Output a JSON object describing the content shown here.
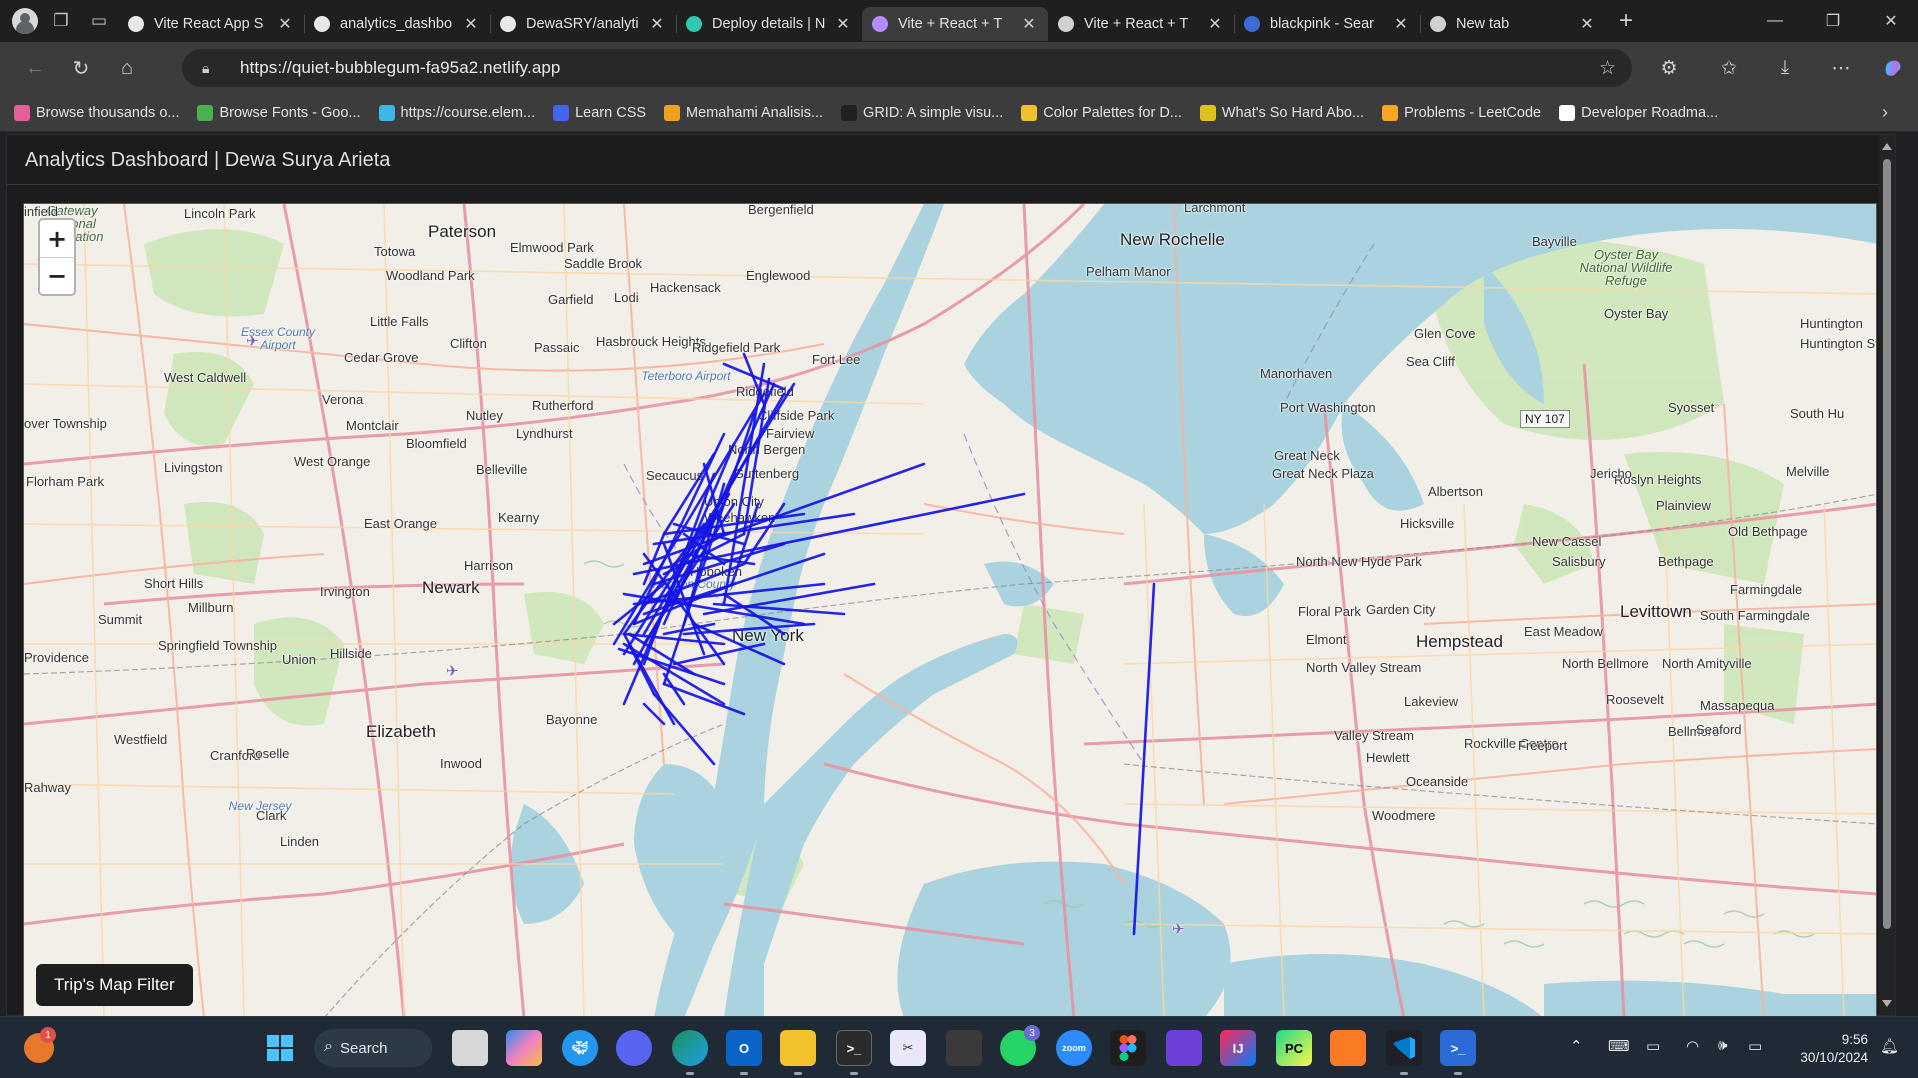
{
  "browser": {
    "tabs": [
      {
        "title": "Vite React App S",
        "favicon_color": "#e8e8e8",
        "active": false
      },
      {
        "title": "analytics_dashbo",
        "favicon_color": "#e8e8e8",
        "active": false
      },
      {
        "title": "DewaSRY/analyti",
        "favicon_color": "#e8e8e8",
        "active": false
      },
      {
        "title": "Deploy details | N",
        "favicon_color": "#30c8b4",
        "active": false
      },
      {
        "title": "Vite + React + T",
        "favicon_color": "#b48cff",
        "active": true
      },
      {
        "title": "Vite + React + T",
        "favicon_color": "#d0d0d0",
        "active": false
      },
      {
        "title": "blackpink - Sear",
        "favicon_color": "#3c6cd8",
        "active": false
      },
      {
        "title": "New tab",
        "favicon_color": "#d0d0d0",
        "active": false
      }
    ],
    "url": "https://quiet-bubblegum-fa95a2.netlify.app",
    "bookmarks": [
      {
        "label": "Browse thousands o...",
        "color": "#e45f9a"
      },
      {
        "label": "Browse Fonts - Goo...",
        "color": "#4caf50"
      },
      {
        "label": "https://course.elem...",
        "color": "#3eb6e8"
      },
      {
        "label": "Learn CSS",
        "color": "#4466ee"
      },
      {
        "label": "Memahami Analisis...",
        "color": "#f0a020"
      },
      {
        "label": "GRID: A simple visu...",
        "color": "#202020"
      },
      {
        "label": "Color Palettes for D...",
        "color": "#f0c030"
      },
      {
        "label": "What's So Hard Abo...",
        "color": "#e0c020"
      },
      {
        "label": "Problems - LeetCode",
        "color": "#f5a623"
      },
      {
        "label": "Developer Roadma...",
        "color": "#ffffff"
      }
    ]
  },
  "page": {
    "title": "Analytics Dashboard | Dewa Surya Arieta",
    "filter_button": "Trip's Map Filter",
    "zoom_in": "+",
    "zoom_out": "−"
  },
  "map": {
    "places": [
      {
        "name": "Lincoln Park",
        "cls": ""
      },
      {
        "name": "Paterson",
        "cls": "big"
      },
      {
        "name": "Totowa",
        "cls": ""
      },
      {
        "name": "Elmwood Park",
        "cls": ""
      },
      {
        "name": "Saddle Brook",
        "cls": ""
      },
      {
        "name": "Woodland Park",
        "cls": ""
      },
      {
        "name": "Hackensack",
        "cls": ""
      },
      {
        "name": "Englewood",
        "cls": ""
      },
      {
        "name": "Bergenfield",
        "cls": ""
      },
      {
        "name": "New Rochelle",
        "cls": "big"
      },
      {
        "name": "Pelham Manor",
        "cls": ""
      },
      {
        "name": "Larchmont",
        "cls": ""
      },
      {
        "name": "Bayville",
        "cls": ""
      },
      {
        "name": "Oyster Bay National Wildlife Refuge",
        "cls": "park"
      },
      {
        "name": "Oyster Bay",
        "cls": ""
      },
      {
        "name": "Glen Cove",
        "cls": ""
      },
      {
        "name": "Sea Cliff",
        "cls": ""
      },
      {
        "name": "Huntington",
        "cls": ""
      },
      {
        "name": "Huntington Station",
        "cls": ""
      },
      {
        "name": "Little Falls",
        "cls": ""
      },
      {
        "name": "Garfield",
        "cls": ""
      },
      {
        "name": "Lodi",
        "cls": ""
      },
      {
        "name": "Clifton",
        "cls": ""
      },
      {
        "name": "Passaic",
        "cls": ""
      },
      {
        "name": "Hasbrouck Heights",
        "cls": ""
      },
      {
        "name": "Ridgefield Park",
        "cls": ""
      },
      {
        "name": "Fort Lee",
        "cls": ""
      },
      {
        "name": "Teterboro Airport",
        "cls": "water"
      },
      {
        "name": "Essex County Airport",
        "cls": "water"
      },
      {
        "name": "Cedar Grove",
        "cls": ""
      },
      {
        "name": "West Caldwell",
        "cls": ""
      },
      {
        "name": "Verona",
        "cls": ""
      },
      {
        "name": "Nutley",
        "cls": ""
      },
      {
        "name": "Rutherford",
        "cls": ""
      },
      {
        "name": "Ridgefield",
        "cls": ""
      },
      {
        "name": "Cliffside Park",
        "cls": ""
      },
      {
        "name": "Fairview",
        "cls": ""
      },
      {
        "name": "Manorhaven",
        "cls": ""
      },
      {
        "name": "Port Washington",
        "cls": ""
      },
      {
        "name": "NY 107",
        "cls": "shield"
      },
      {
        "name": "Syosset",
        "cls": ""
      },
      {
        "name": "South Hu",
        "cls": ""
      },
      {
        "name": "over Township",
        "cls": ""
      },
      {
        "name": "Montclair",
        "cls": ""
      },
      {
        "name": "Bloomfield",
        "cls": ""
      },
      {
        "name": "Lyndhurst",
        "cls": ""
      },
      {
        "name": "North Bergen",
        "cls": ""
      },
      {
        "name": "Livingston",
        "cls": ""
      },
      {
        "name": "West Orange",
        "cls": ""
      },
      {
        "name": "Belleville",
        "cls": ""
      },
      {
        "name": "Secaucus",
        "cls": ""
      },
      {
        "name": "Guttenberg",
        "cls": ""
      },
      {
        "name": "Great Neck",
        "cls": ""
      },
      {
        "name": "Great Neck Plaza",
        "cls": ""
      },
      {
        "name": "Roslyn Heights",
        "cls": ""
      },
      {
        "name": "Albertson",
        "cls": ""
      },
      {
        "name": "Jericho",
        "cls": ""
      },
      {
        "name": "Melville",
        "cls": ""
      },
      {
        "name": "Plainview",
        "cls": ""
      },
      {
        "name": "Florham Park",
        "cls": ""
      },
      {
        "name": "Union City",
        "cls": ""
      },
      {
        "name": "Weehawken",
        "cls": ""
      },
      {
        "name": "Hicksville",
        "cls": ""
      },
      {
        "name": "Old Bethpage",
        "cls": ""
      },
      {
        "name": "East Orange",
        "cls": ""
      },
      {
        "name": "Kearny",
        "cls": ""
      },
      {
        "name": "Harrison",
        "cls": ""
      },
      {
        "name": "Hoboken",
        "cls": ""
      },
      {
        "name": "North New Hyde Park",
        "cls": ""
      },
      {
        "name": "New Cassel",
        "cls": ""
      },
      {
        "name": "Salisbury",
        "cls": ""
      },
      {
        "name": "Bethpage",
        "cls": ""
      },
      {
        "name": "Short Hills",
        "cls": ""
      },
      {
        "name": "Irvington",
        "cls": ""
      },
      {
        "name": "Newark",
        "cls": "big"
      },
      {
        "name": "Hudson County",
        "cls": "water"
      },
      {
        "name": "Farmingdale",
        "cls": ""
      },
      {
        "name": "Millburn",
        "cls": ""
      },
      {
        "name": "Summit",
        "cls": ""
      },
      {
        "name": "New York",
        "cls": "big"
      },
      {
        "name": "Floral Park",
        "cls": ""
      },
      {
        "name": "Garden City",
        "cls": ""
      },
      {
        "name": "Levittown",
        "cls": "big"
      },
      {
        "name": "South Farmingdale",
        "cls": ""
      },
      {
        "name": "Springfield Township",
        "cls": ""
      },
      {
        "name": "Hillside",
        "cls": ""
      },
      {
        "name": "Union",
        "cls": ""
      },
      {
        "name": "Providence",
        "cls": ""
      },
      {
        "name": "Elmont",
        "cls": ""
      },
      {
        "name": "Hempstead",
        "cls": "big"
      },
      {
        "name": "East Meadow",
        "cls": ""
      },
      {
        "name": "North Amityville",
        "cls": ""
      },
      {
        "name": "North Bellmore",
        "cls": ""
      },
      {
        "name": "North Valley Stream",
        "cls": ""
      },
      {
        "name": "Lakeview",
        "cls": ""
      },
      {
        "name": "Roosevelt",
        "cls": ""
      },
      {
        "name": "Massapequa",
        "cls": ""
      },
      {
        "name": "Bayonne",
        "cls": ""
      },
      {
        "name": "Elizabeth",
        "cls": "big"
      },
      {
        "name": "Westfield",
        "cls": ""
      },
      {
        "name": "Cranford",
        "cls": ""
      },
      {
        "name": "Roselle",
        "cls": ""
      },
      {
        "name": "Valley Stream",
        "cls": ""
      },
      {
        "name": "Rockville Centre",
        "cls": ""
      },
      {
        "name": "Freeport",
        "cls": ""
      },
      {
        "name": "Bellmore",
        "cls": ""
      },
      {
        "name": "Seaford",
        "cls": ""
      },
      {
        "name": "Hewlett",
        "cls": ""
      },
      {
        "name": "Oceanside",
        "cls": ""
      },
      {
        "name": "Woodmere",
        "cls": ""
      },
      {
        "name": "Inwood",
        "cls": ""
      },
      {
        "name": "New Jersey",
        "cls": "water"
      },
      {
        "name": "Clark",
        "cls": ""
      },
      {
        "name": "Linden",
        "cls": ""
      },
      {
        "name": "Rahway",
        "cls": ""
      },
      {
        "name": "Gateway National Recreation",
        "cls": "park"
      },
      {
        "name": "infield",
        "cls": ""
      }
    ],
    "trip_lines_color": "#1414e6",
    "trip_count": 58
  },
  "taskbar": {
    "search_label": "Search",
    "time": "9:56",
    "date": "30/10/2024",
    "whatsapp_badge": "3",
    "weather_badge": "1"
  }
}
